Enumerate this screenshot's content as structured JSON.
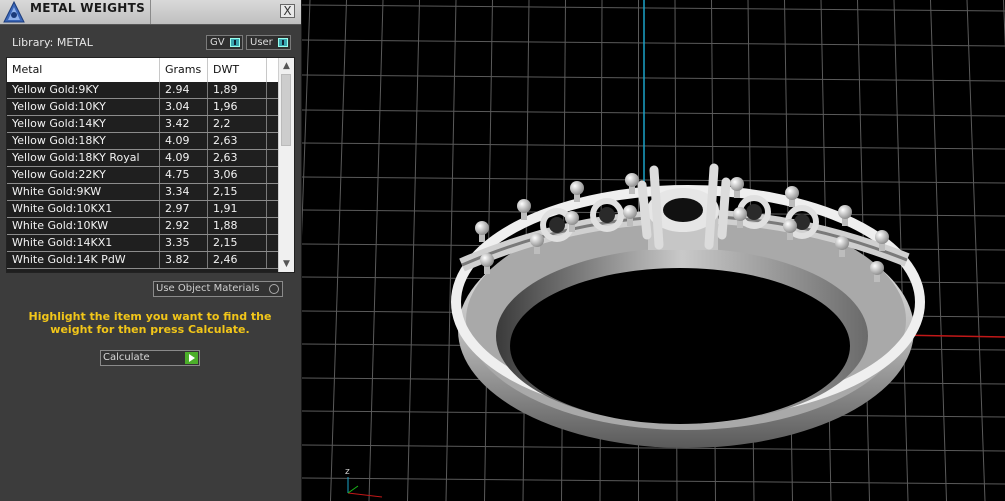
{
  "panel": {
    "title": "METAL WEIGHTS",
    "close_label": "X",
    "library_label": "Library: METAL",
    "toggles": {
      "gv": "GV",
      "user": "User"
    },
    "table": {
      "headers": [
        "Metal",
        "Grams",
        "DWT"
      ],
      "rows": [
        [
          "Yellow Gold:9KY",
          "2.94",
          "1,89"
        ],
        [
          "Yellow Gold:10KY",
          "3.04",
          "1,96"
        ],
        [
          "Yellow Gold:14KY",
          "3.42",
          "2,2"
        ],
        [
          "Yellow Gold:18KY",
          "4.09",
          "2,63"
        ],
        [
          "Yellow Gold:18KY Royal",
          "4.09",
          "2,63"
        ],
        [
          "Yellow Gold:22KY",
          "4.75",
          "3,06"
        ],
        [
          "White Gold:9KW",
          "3.34",
          "2,15"
        ],
        [
          "White Gold:10KX1",
          "2.97",
          "1,91"
        ],
        [
          "White Gold:10KW",
          "2.92",
          "1,88"
        ],
        [
          "White Gold:14KX1",
          "3.35",
          "2,15"
        ],
        [
          "White Gold:14K PdW",
          "3.82",
          "2,46"
        ]
      ]
    },
    "use_object_materials": "Use Object Materials",
    "hint": "Highlight the item you want to find the weight for then press Calculate.",
    "calculate": "Calculate"
  },
  "viewport": {
    "axis_label_z": "z",
    "colors": {
      "x_axis": "#c21818",
      "z_axis": "#1aa3c8",
      "y_axis": "#18b818",
      "grid": "#5a5a5a"
    }
  }
}
